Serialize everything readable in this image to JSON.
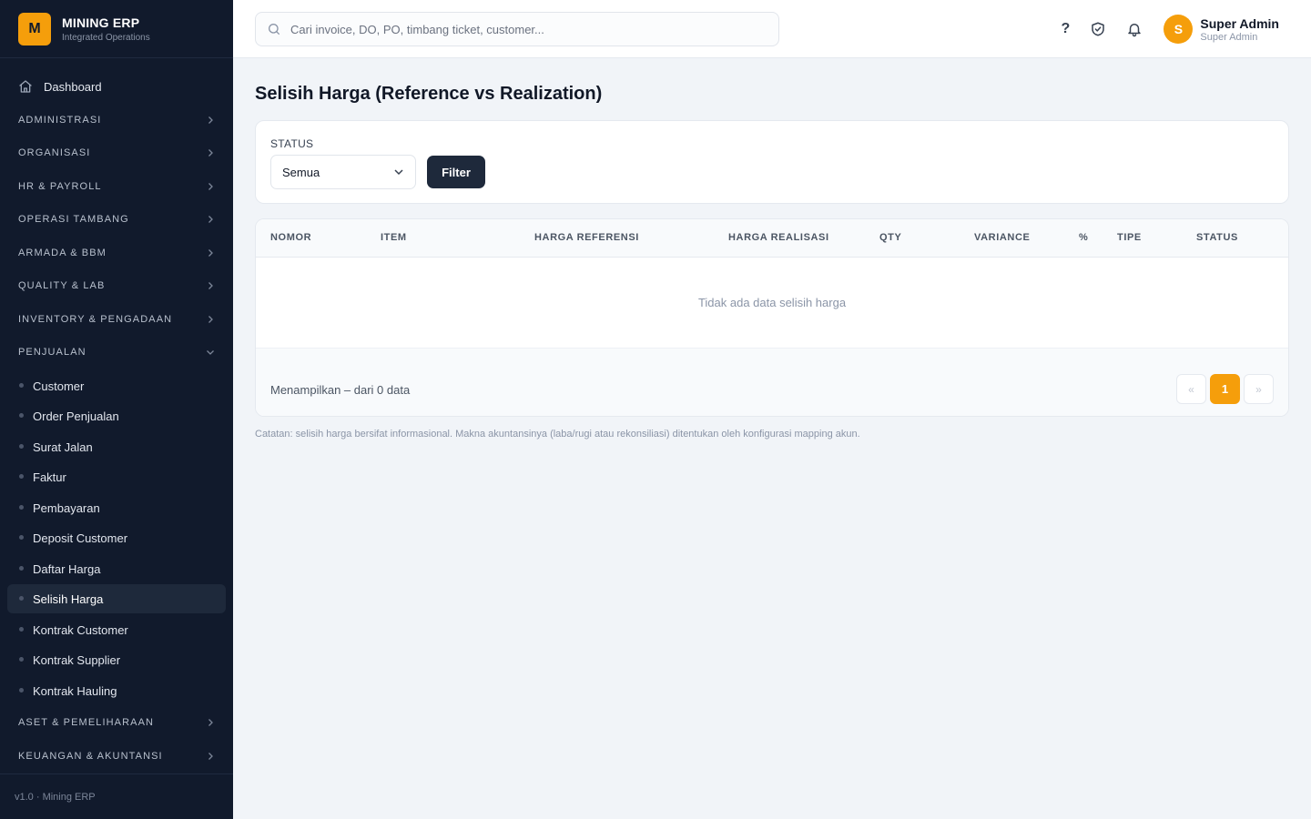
{
  "brand": {
    "logo_letter": "M",
    "name": "MINING ERP",
    "subtitle": "Integrated Operations",
    "accent": "#f59e0b"
  },
  "sidebar": {
    "dashboard": {
      "label": "Dashboard",
      "icon": "home-icon"
    },
    "sections": [
      {
        "label": "ADMINISTRASI",
        "expanded": false
      },
      {
        "label": "ORGANISASI",
        "expanded": false
      },
      {
        "label": "HR & PAYROLL",
        "expanded": false
      },
      {
        "label": "OPERASI TAMBANG",
        "expanded": false
      },
      {
        "label": "ARMADA & BBM",
        "expanded": false
      },
      {
        "label": "QUALITY & LAB",
        "expanded": false
      },
      {
        "label": "INVENTORY & PENGADAAN",
        "expanded": false
      },
      {
        "label": "PENJUALAN",
        "expanded": true
      },
      {
        "label": "ASET & PEMELIHARAAN",
        "expanded": false
      },
      {
        "label": "KEUANGAN & AKUNTANSI",
        "expanded": false
      }
    ],
    "penjualan_items": [
      {
        "label": "Customer"
      },
      {
        "label": "Order Penjualan"
      },
      {
        "label": "Surat Jalan"
      },
      {
        "label": "Faktur"
      },
      {
        "label": "Pembayaran"
      },
      {
        "label": "Deposit Customer"
      },
      {
        "label": "Daftar Harga"
      },
      {
        "label": "Selisih Harga",
        "active": true
      },
      {
        "label": "Kontrak Customer"
      },
      {
        "label": "Kontrak Supplier"
      },
      {
        "label": "Kontrak Hauling"
      }
    ],
    "footer": "v1.0 · Mining ERP"
  },
  "topbar": {
    "search_placeholder": "Cari invoice, DO, PO, timbang ticket, customer...",
    "help_label": "?",
    "user": {
      "initial": "S",
      "name": "Super Admin",
      "role": "Super Admin"
    }
  },
  "page": {
    "title": "Selisih Harga (Reference vs Realization)",
    "filter": {
      "label": "STATUS",
      "selected": "Semua",
      "button": "Filter"
    },
    "table": {
      "columns": [
        "NOMOR",
        "ITEM",
        "HARGA REFERENSI",
        "HARGA REALISASI",
        "QTY",
        "VARIANCE",
        "%",
        "TIPE",
        "STATUS"
      ],
      "rows": [],
      "empty_text": "Tidak ada data selisih harga"
    },
    "pagination": {
      "showing": "Menampilkan – dari 0 data",
      "prev": "«",
      "current": "1",
      "next": "»"
    },
    "note": "Catatan: selisih harga bersifat informasional. Makna akuntansinya (laba/rugi atau rekonsiliasi) ditentukan oleh konfigurasi mapping akun."
  }
}
